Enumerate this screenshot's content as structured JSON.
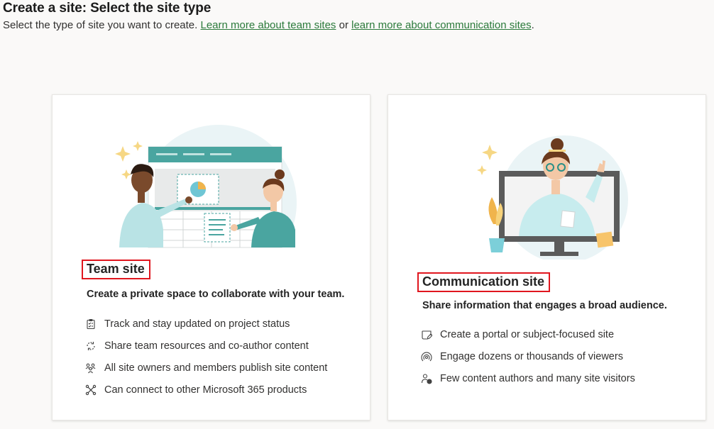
{
  "header": {
    "title": "Create a site: Select the site type",
    "subtitle_prefix": "Select the type of site you want to create. ",
    "link_team": "Learn more about team sites",
    "subtitle_mid": " or ",
    "link_comm": "learn more about communication sites",
    "subtitle_suffix": "."
  },
  "team_site": {
    "title": "Team site",
    "description": "Create a private space to collaborate with your team.",
    "features": [
      {
        "icon": "clipboard-checklist-icon",
        "label": "Track and stay updated on project status"
      },
      {
        "icon": "sync-circle-icon",
        "label": "Share team resources and co-author content"
      },
      {
        "icon": "people-group-icon",
        "label": "All site owners and members publish site content"
      },
      {
        "icon": "connector-icon",
        "label": "Can connect to other Microsoft 365 products"
      }
    ]
  },
  "communication_site": {
    "title": "Communication site",
    "description": "Share information that engages a broad audience.",
    "features": [
      {
        "icon": "edit-note-icon",
        "label": "Create a portal or subject-focused site"
      },
      {
        "icon": "broadcast-icon",
        "label": "Engage dozens or thousands of viewers"
      },
      {
        "icon": "person-chat-icon",
        "label": "Few content authors and many site visitors"
      }
    ]
  },
  "colors": {
    "link": "#2b7a3b",
    "highlight_border": "#e0161e",
    "teal": "#4aa5a0",
    "card_bg": "#ffffff",
    "page_bg": "#faf9f8"
  }
}
